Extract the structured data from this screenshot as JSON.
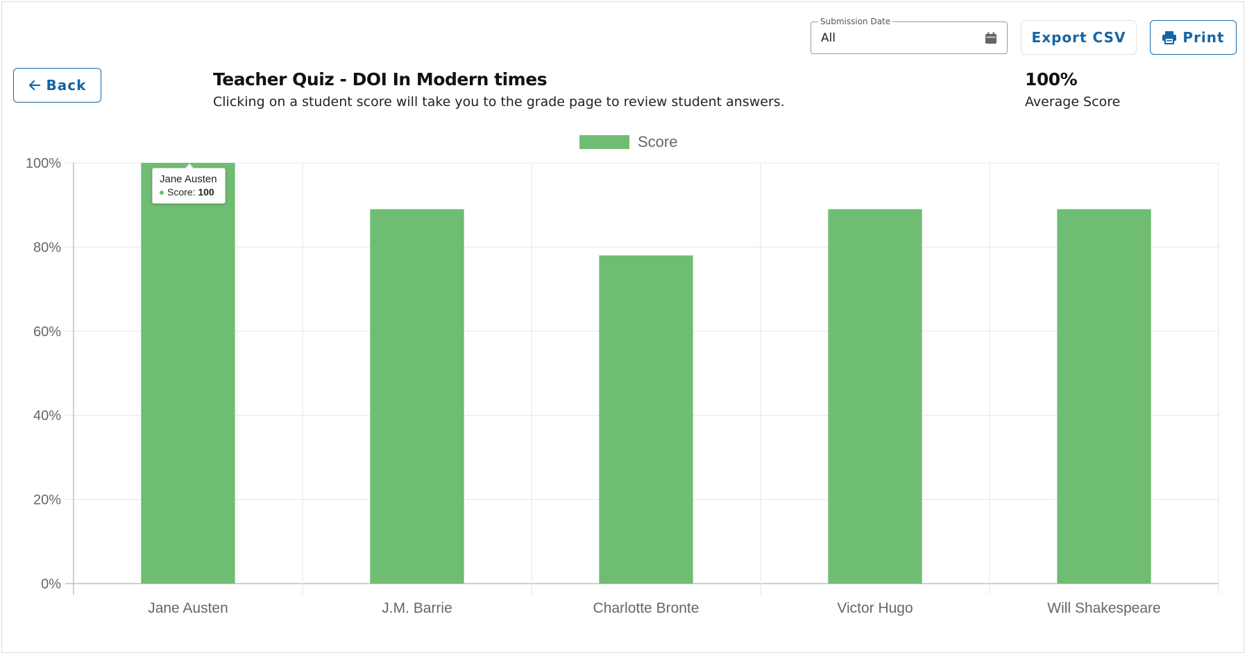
{
  "header": {
    "date_filter": {
      "label": "Submission Date",
      "value": "All",
      "icon": "calendar-icon"
    },
    "export_label": "Export CSV",
    "print_label": "Print",
    "print_icon": "printer-icon"
  },
  "back_label": "Back",
  "back_icon": "arrow-left-icon",
  "quiz": {
    "title": "Teacher Quiz - DOI In Modern times",
    "subtitle": "Clicking on a student score will take you to the grade page to review student answers.",
    "average_value": "100%",
    "average_label": "Average Score"
  },
  "tooltip": {
    "name": "Jane Austen",
    "series_label": "Score: ",
    "value": "100"
  },
  "colors": {
    "accent": "#1565a6",
    "bar": "#6fbd73",
    "grid": "#e6e6e6",
    "axis_text": "#666666"
  },
  "chart_data": {
    "type": "bar",
    "categories": [
      "Jane Austen",
      "J.M. Barrie",
      "Charlotte Bronte",
      "Victor Hugo",
      "Will Shakespeare"
    ],
    "series": [
      {
        "name": "Score",
        "values": [
          100,
          89,
          78,
          89,
          89
        ]
      }
    ],
    "ylim": [
      0,
      100
    ],
    "yticks": [
      "0%",
      "20%",
      "40%",
      "60%",
      "80%",
      "100%"
    ],
    "legend": "top-center",
    "grid": true
  }
}
